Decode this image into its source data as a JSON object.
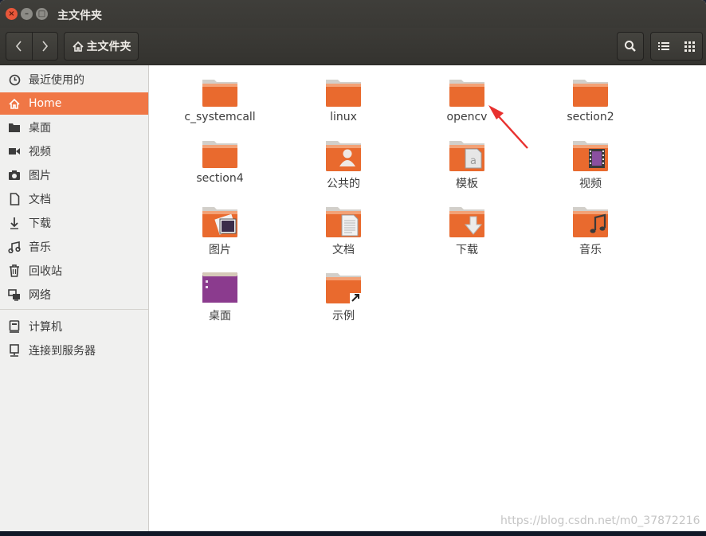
{
  "window": {
    "title": "主文件夹",
    "controls": {
      "close": "×",
      "minimize": "–",
      "maximize": "□"
    }
  },
  "toolbar": {
    "back_icon": "chevron-left-icon",
    "forward_icon": "chevron-right-icon",
    "path_label": "主文件夹",
    "path_icon": "home-icon",
    "search_icon": "search-icon",
    "list_view_icon": "list-view-icon",
    "grid_view_icon": "grid-view-icon"
  },
  "sidebar": {
    "items": [
      {
        "label": "最近使用的",
        "icon": "clock-icon",
        "active": false
      },
      {
        "label": "Home",
        "icon": "home-icon",
        "active": true
      },
      {
        "label": "桌面",
        "icon": "desktop-folder-icon",
        "active": false
      },
      {
        "label": "视频",
        "icon": "video-icon",
        "active": false
      },
      {
        "label": "图片",
        "icon": "camera-icon",
        "active": false
      },
      {
        "label": "文档",
        "icon": "document-icon",
        "active": false
      },
      {
        "label": "下载",
        "icon": "download-icon",
        "active": false
      },
      {
        "label": "音乐",
        "icon": "music-icon",
        "active": false
      },
      {
        "label": "回收站",
        "icon": "trash-icon",
        "active": false
      },
      {
        "label": "网络",
        "icon": "network-icon",
        "active": false
      },
      {
        "label": "计算机",
        "icon": "computer-icon",
        "active": false
      },
      {
        "label": "连接到服务器",
        "icon": "server-icon",
        "active": false
      }
    ]
  },
  "files": [
    {
      "label": "c_systemcall",
      "icon": "folder-icon"
    },
    {
      "label": "linux",
      "icon": "folder-icon"
    },
    {
      "label": "opencv",
      "icon": "folder-icon"
    },
    {
      "label": "section2",
      "icon": "folder-icon"
    },
    {
      "label": "section4",
      "icon": "folder-icon"
    },
    {
      "label": "公共的",
      "icon": "public-folder-icon"
    },
    {
      "label": "模板",
      "icon": "templates-folder-icon"
    },
    {
      "label": "视频",
      "icon": "videos-folder-icon"
    },
    {
      "label": "图片",
      "icon": "pictures-folder-icon"
    },
    {
      "label": "文档",
      "icon": "documents-folder-icon"
    },
    {
      "label": "下载",
      "icon": "downloads-folder-icon"
    },
    {
      "label": "音乐",
      "icon": "music-folder-icon"
    },
    {
      "label": "桌面",
      "icon": "desktop-folder-icon"
    },
    {
      "label": "示例",
      "icon": "examples-folder-icon"
    }
  ],
  "annotation": {
    "icon": "red-arrow-icon",
    "color": "#e8312f"
  },
  "watermark": "https://blog.csdn.net/m0_37872216",
  "colors": {
    "accent": "#f07746",
    "folder": "#e96a2e",
    "titlebar": "#3c3b37"
  }
}
